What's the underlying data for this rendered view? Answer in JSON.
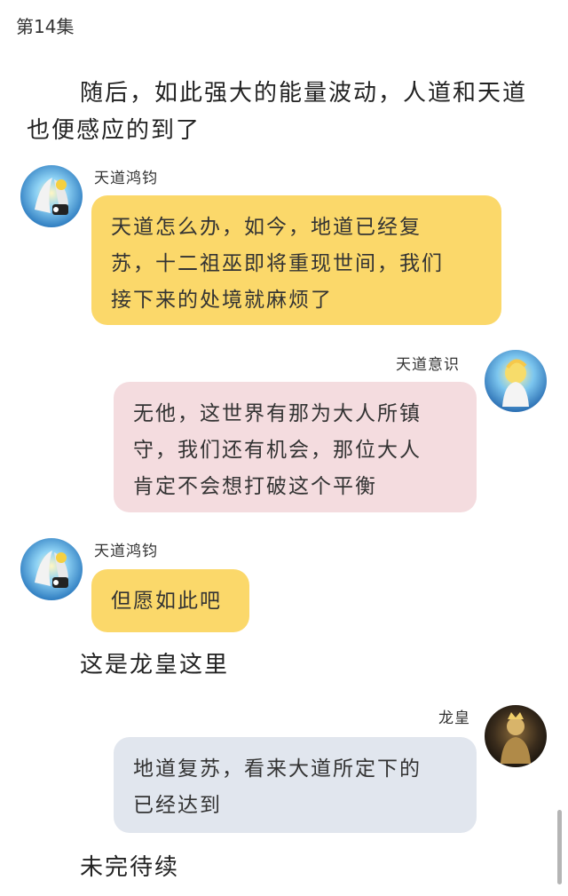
{
  "chapter": "第14集",
  "narration": {
    "intro_line1": "随后，如此强大的能量波动，人道和天道",
    "intro_line2": "也便感应的到了",
    "dragon_section": "这是龙皇这里",
    "ending": "未完待续"
  },
  "messages": [
    {
      "speaker": "天道鸿钧",
      "lines": [
        "天道怎么办，如今，地道已经复",
        "苏，十二祖巫即将重现世间，我们",
        "接下来的处境就麻烦了"
      ],
      "color": "#fbd86a"
    },
    {
      "speaker": "天道意识",
      "lines": [
        "无他，这世界有那为大人所镇",
        "守，我们还有机会，那位大人",
        "肯定不会想打破这个平衡"
      ],
      "color": "#f4dcdf"
    },
    {
      "speaker": "天道鸿钧",
      "lines": [
        "但愿如此吧"
      ],
      "color": "#fbd86a"
    },
    {
      "speaker": "龙皇",
      "lines": [
        "地道复苏，看来大道所定下的",
        "已经达到"
      ],
      "color": "#e1e6ee"
    }
  ]
}
